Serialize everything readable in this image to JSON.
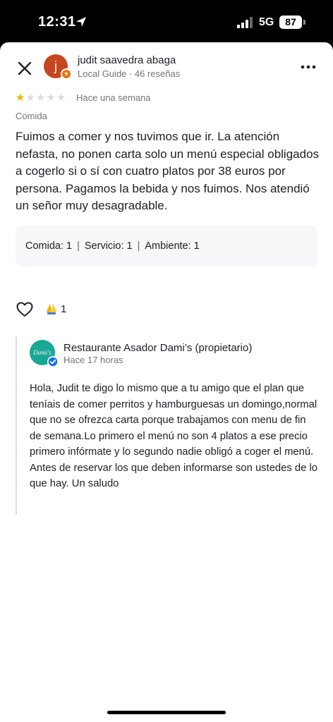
{
  "status_bar": {
    "time": "12:31",
    "network": "5G",
    "battery": "87"
  },
  "reviewer": {
    "initial": "j",
    "name": "judit saavedra abaga",
    "meta": "Local Guide · 46 reseñas"
  },
  "review": {
    "rating": 1,
    "max_rating": 5,
    "time_ago": "Hace una semana",
    "category": "Comida",
    "text": "Fuimos a comer y nos tuvimos que ir. La atención nefasta, no ponen carta solo un menú especial obligados a cogerlo si o sí con cuatro platos por 38 euros por persona. Pagamos la bebida y nos fuimos. Nos atendió un señor muy desagradable."
  },
  "ratings": {
    "food": "Comida: 1",
    "service": "Servicio: 1",
    "ambience": "Ambiente: 1",
    "separator": "|"
  },
  "reactions": {
    "count": "1"
  },
  "owner_reply": {
    "avatar_text": "Dami's",
    "name": "Restaurante Asador Dami’s (propietario)",
    "time_ago": "Hace 17 horas",
    "text": "Hola, Judit te digo lo mismo que a tu amigo que el plan que teníais de comer perritos y hamburguesas un domingo,normal que no se ofrezca carta porque trabajamos con menu de fin de semana.Lo primero el menú no son 4 platos a ese precio primero infórmate y lo segundo nadie obligó a coger el menú. Antes de reservar los que deben informarse son ustedes de lo que hay. Un saludo"
  },
  "colors": {
    "star_filled": "#f4b400",
    "star_empty": "#dadce0",
    "avatar_bg": "#c5451f",
    "owner_avatar_bg": "#1aa795",
    "verified_blue": "#1a73e8"
  },
  "icons": [
    "location-arrow-icon",
    "signal-icon",
    "battery-icon",
    "close-icon",
    "local-guide-badge-icon",
    "more-icon",
    "star-icon",
    "heart-icon",
    "pray-icon",
    "verified-icon"
  ]
}
